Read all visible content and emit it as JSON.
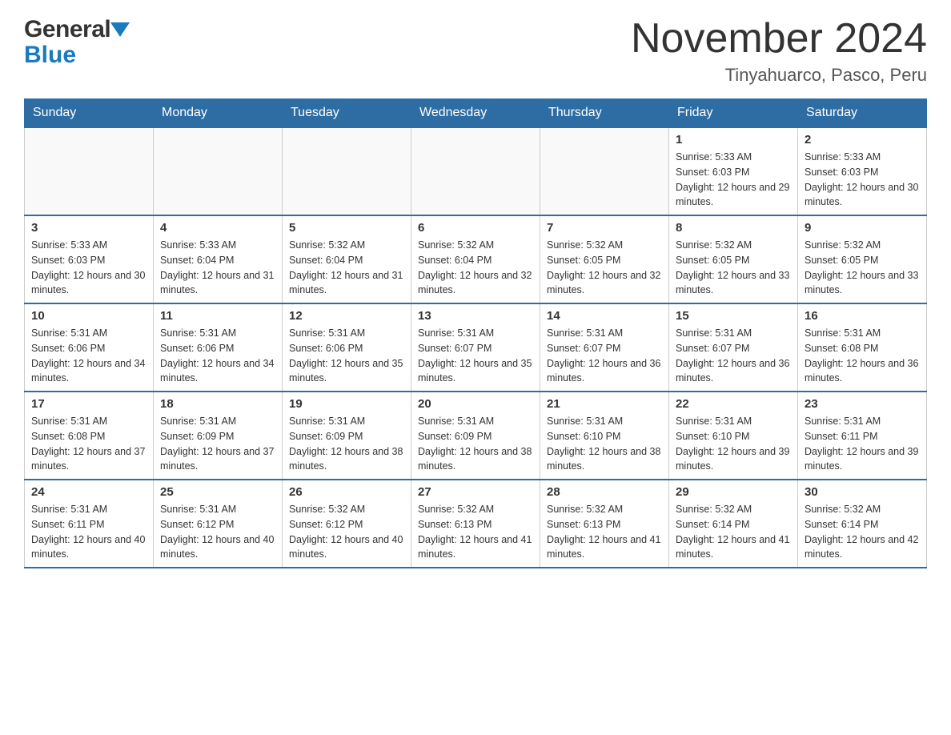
{
  "header": {
    "logo_general": "General",
    "logo_blue": "Blue",
    "month_title": "November 2024",
    "location": "Tinyahuarco, Pasco, Peru"
  },
  "weekdays": [
    "Sunday",
    "Monday",
    "Tuesday",
    "Wednesday",
    "Thursday",
    "Friday",
    "Saturday"
  ],
  "weeks": [
    [
      {
        "day": "",
        "sunrise": "",
        "sunset": "",
        "daylight": ""
      },
      {
        "day": "",
        "sunrise": "",
        "sunset": "",
        "daylight": ""
      },
      {
        "day": "",
        "sunrise": "",
        "sunset": "",
        "daylight": ""
      },
      {
        "day": "",
        "sunrise": "",
        "sunset": "",
        "daylight": ""
      },
      {
        "day": "",
        "sunrise": "",
        "sunset": "",
        "daylight": ""
      },
      {
        "day": "1",
        "sunrise": "Sunrise: 5:33 AM",
        "sunset": "Sunset: 6:03 PM",
        "daylight": "Daylight: 12 hours and 29 minutes."
      },
      {
        "day": "2",
        "sunrise": "Sunrise: 5:33 AM",
        "sunset": "Sunset: 6:03 PM",
        "daylight": "Daylight: 12 hours and 30 minutes."
      }
    ],
    [
      {
        "day": "3",
        "sunrise": "Sunrise: 5:33 AM",
        "sunset": "Sunset: 6:03 PM",
        "daylight": "Daylight: 12 hours and 30 minutes."
      },
      {
        "day": "4",
        "sunrise": "Sunrise: 5:33 AM",
        "sunset": "Sunset: 6:04 PM",
        "daylight": "Daylight: 12 hours and 31 minutes."
      },
      {
        "day": "5",
        "sunrise": "Sunrise: 5:32 AM",
        "sunset": "Sunset: 6:04 PM",
        "daylight": "Daylight: 12 hours and 31 minutes."
      },
      {
        "day": "6",
        "sunrise": "Sunrise: 5:32 AM",
        "sunset": "Sunset: 6:04 PM",
        "daylight": "Daylight: 12 hours and 32 minutes."
      },
      {
        "day": "7",
        "sunrise": "Sunrise: 5:32 AM",
        "sunset": "Sunset: 6:05 PM",
        "daylight": "Daylight: 12 hours and 32 minutes."
      },
      {
        "day": "8",
        "sunrise": "Sunrise: 5:32 AM",
        "sunset": "Sunset: 6:05 PM",
        "daylight": "Daylight: 12 hours and 33 minutes."
      },
      {
        "day": "9",
        "sunrise": "Sunrise: 5:32 AM",
        "sunset": "Sunset: 6:05 PM",
        "daylight": "Daylight: 12 hours and 33 minutes."
      }
    ],
    [
      {
        "day": "10",
        "sunrise": "Sunrise: 5:31 AM",
        "sunset": "Sunset: 6:06 PM",
        "daylight": "Daylight: 12 hours and 34 minutes."
      },
      {
        "day": "11",
        "sunrise": "Sunrise: 5:31 AM",
        "sunset": "Sunset: 6:06 PM",
        "daylight": "Daylight: 12 hours and 34 minutes."
      },
      {
        "day": "12",
        "sunrise": "Sunrise: 5:31 AM",
        "sunset": "Sunset: 6:06 PM",
        "daylight": "Daylight: 12 hours and 35 minutes."
      },
      {
        "day": "13",
        "sunrise": "Sunrise: 5:31 AM",
        "sunset": "Sunset: 6:07 PM",
        "daylight": "Daylight: 12 hours and 35 minutes."
      },
      {
        "day": "14",
        "sunrise": "Sunrise: 5:31 AM",
        "sunset": "Sunset: 6:07 PM",
        "daylight": "Daylight: 12 hours and 36 minutes."
      },
      {
        "day": "15",
        "sunrise": "Sunrise: 5:31 AM",
        "sunset": "Sunset: 6:07 PM",
        "daylight": "Daylight: 12 hours and 36 minutes."
      },
      {
        "day": "16",
        "sunrise": "Sunrise: 5:31 AM",
        "sunset": "Sunset: 6:08 PM",
        "daylight": "Daylight: 12 hours and 36 minutes."
      }
    ],
    [
      {
        "day": "17",
        "sunrise": "Sunrise: 5:31 AM",
        "sunset": "Sunset: 6:08 PM",
        "daylight": "Daylight: 12 hours and 37 minutes."
      },
      {
        "day": "18",
        "sunrise": "Sunrise: 5:31 AM",
        "sunset": "Sunset: 6:09 PM",
        "daylight": "Daylight: 12 hours and 37 minutes."
      },
      {
        "day": "19",
        "sunrise": "Sunrise: 5:31 AM",
        "sunset": "Sunset: 6:09 PM",
        "daylight": "Daylight: 12 hours and 38 minutes."
      },
      {
        "day": "20",
        "sunrise": "Sunrise: 5:31 AM",
        "sunset": "Sunset: 6:09 PM",
        "daylight": "Daylight: 12 hours and 38 minutes."
      },
      {
        "day": "21",
        "sunrise": "Sunrise: 5:31 AM",
        "sunset": "Sunset: 6:10 PM",
        "daylight": "Daylight: 12 hours and 38 minutes."
      },
      {
        "day": "22",
        "sunrise": "Sunrise: 5:31 AM",
        "sunset": "Sunset: 6:10 PM",
        "daylight": "Daylight: 12 hours and 39 minutes."
      },
      {
        "day": "23",
        "sunrise": "Sunrise: 5:31 AM",
        "sunset": "Sunset: 6:11 PM",
        "daylight": "Daylight: 12 hours and 39 minutes."
      }
    ],
    [
      {
        "day": "24",
        "sunrise": "Sunrise: 5:31 AM",
        "sunset": "Sunset: 6:11 PM",
        "daylight": "Daylight: 12 hours and 40 minutes."
      },
      {
        "day": "25",
        "sunrise": "Sunrise: 5:31 AM",
        "sunset": "Sunset: 6:12 PM",
        "daylight": "Daylight: 12 hours and 40 minutes."
      },
      {
        "day": "26",
        "sunrise": "Sunrise: 5:32 AM",
        "sunset": "Sunset: 6:12 PM",
        "daylight": "Daylight: 12 hours and 40 minutes."
      },
      {
        "day": "27",
        "sunrise": "Sunrise: 5:32 AM",
        "sunset": "Sunset: 6:13 PM",
        "daylight": "Daylight: 12 hours and 41 minutes."
      },
      {
        "day": "28",
        "sunrise": "Sunrise: 5:32 AM",
        "sunset": "Sunset: 6:13 PM",
        "daylight": "Daylight: 12 hours and 41 minutes."
      },
      {
        "day": "29",
        "sunrise": "Sunrise: 5:32 AM",
        "sunset": "Sunset: 6:14 PM",
        "daylight": "Daylight: 12 hours and 41 minutes."
      },
      {
        "day": "30",
        "sunrise": "Sunrise: 5:32 AM",
        "sunset": "Sunset: 6:14 PM",
        "daylight": "Daylight: 12 hours and 42 minutes."
      }
    ]
  ]
}
